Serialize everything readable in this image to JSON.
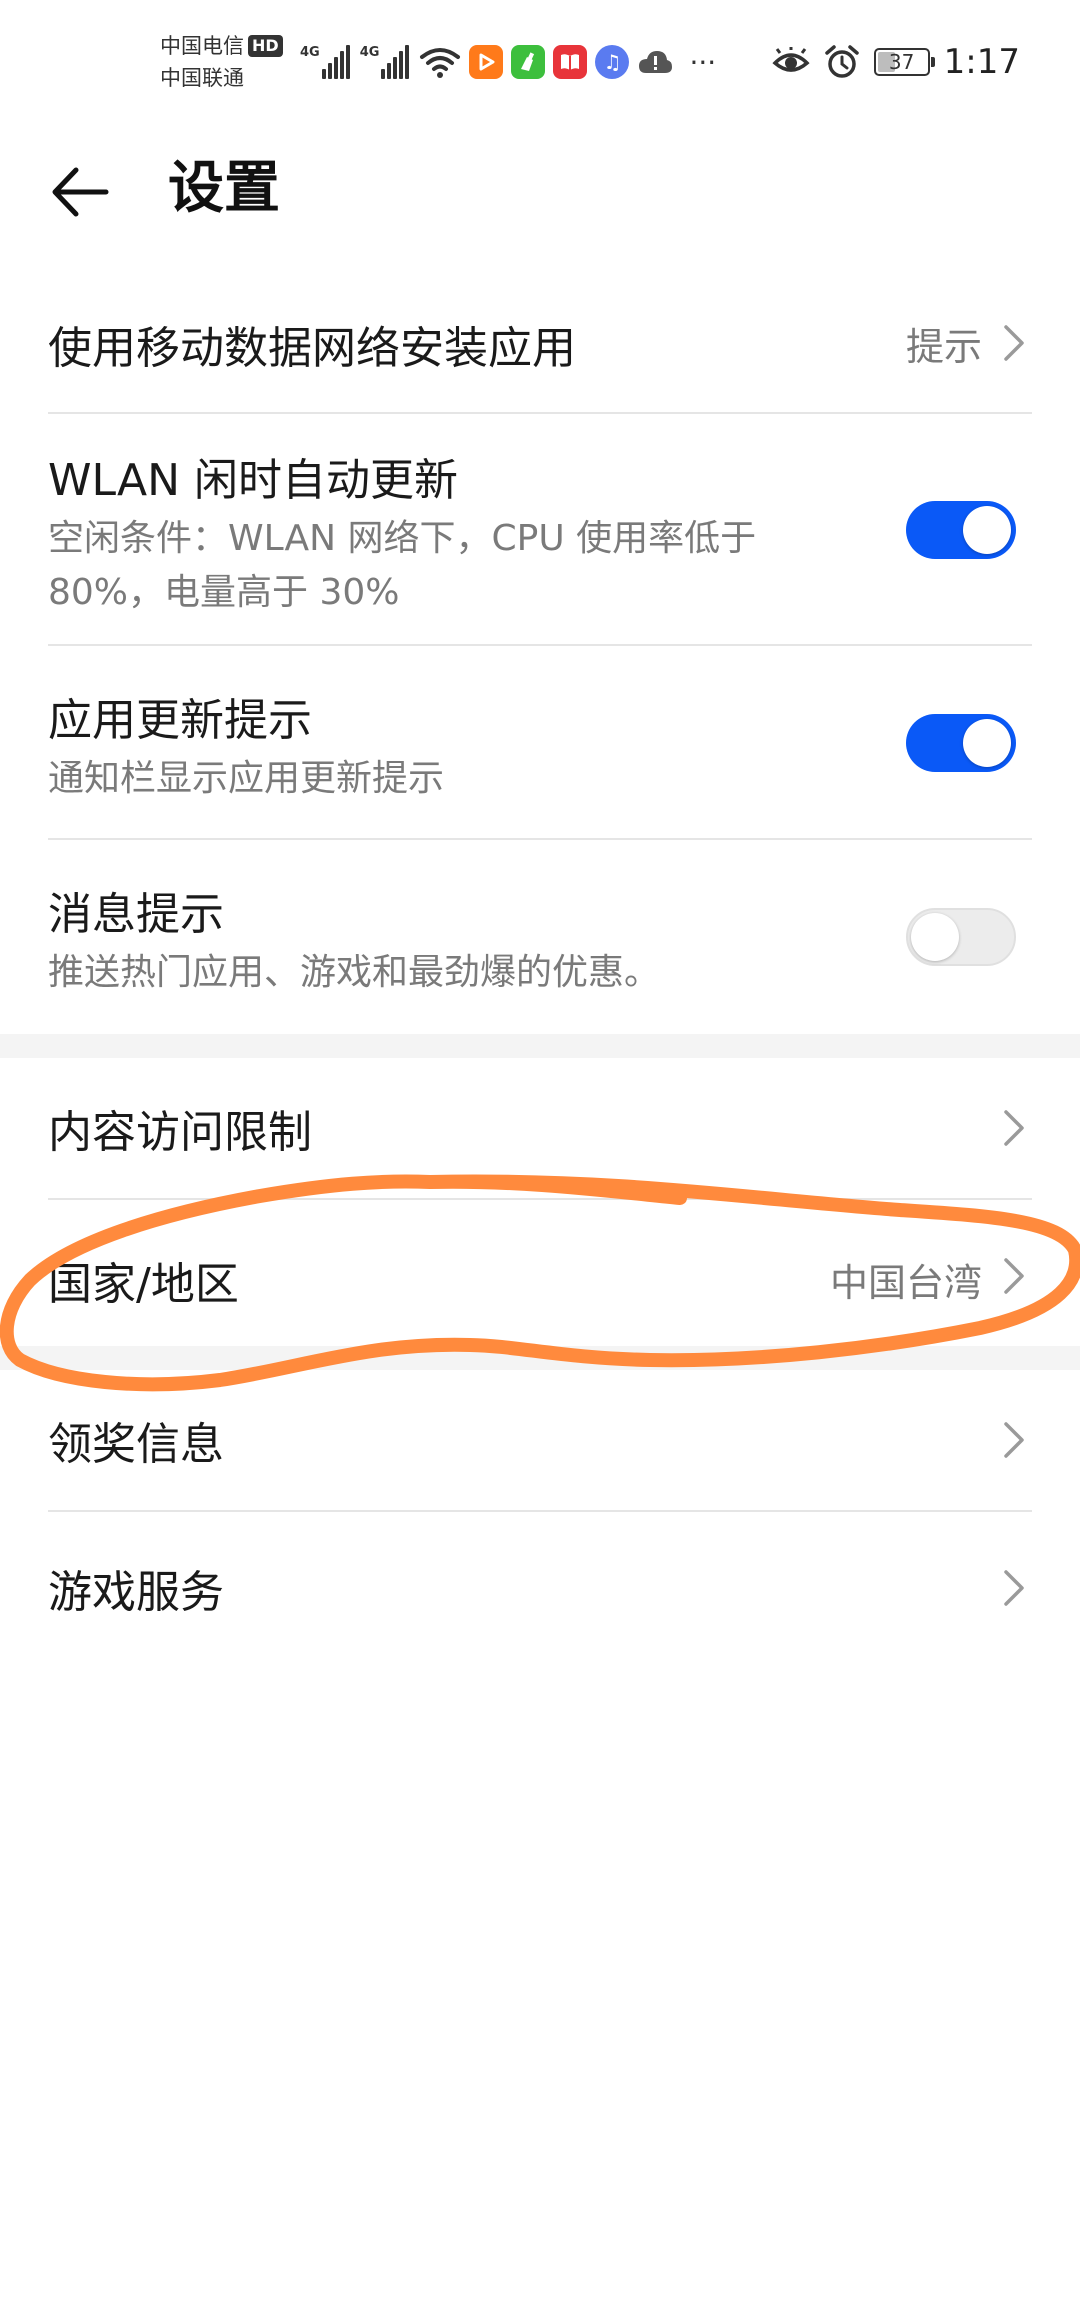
{
  "status_bar": {
    "carrier_1": "中国电信",
    "hd_badge": "HD",
    "carrier_2": "中国联通",
    "network_1": "4G",
    "network_2": "4G",
    "more": "···",
    "battery": "37",
    "battery_level_percent": 37,
    "time": "1:17"
  },
  "header": {
    "title": "设置"
  },
  "settings": {
    "mobile_install": {
      "label": "使用移动数据网络安装应用",
      "value": "提示"
    },
    "wlan_auto_update": {
      "label": "WLAN 闲时自动更新",
      "desc": "空闲条件：WLAN 网络下，CPU 使用率低于 80%，电量高于 30%",
      "enabled": true
    },
    "update_notice": {
      "label": "应用更新提示",
      "desc": "通知栏显示应用更新提示",
      "enabled": true
    },
    "message_notice": {
      "label": "消息提示",
      "desc": "推送热门应用、游戏和最劲爆的优惠。",
      "enabled": false
    },
    "content_restriction": {
      "label": "内容访问限制"
    },
    "region": {
      "label": "国家/地区",
      "value": "中国台湾"
    },
    "prize_info": {
      "label": "领奖信息"
    },
    "game_service": {
      "label": "游戏服务"
    }
  },
  "colors": {
    "accent": "#0a59f7",
    "annotation": "#ff8a3d",
    "divider": "#e5e5e5",
    "secondary_text": "#7a7a7a"
  }
}
